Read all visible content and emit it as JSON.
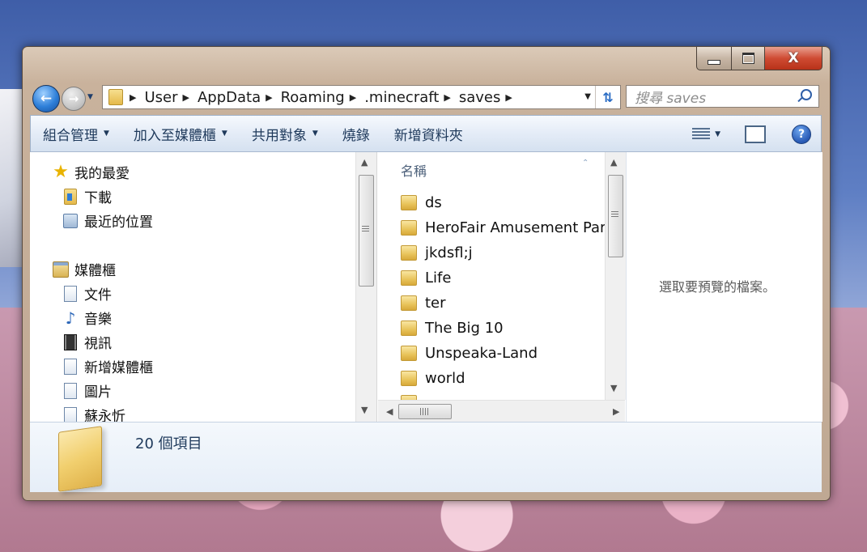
{
  "window": {
    "close_glyph": "X"
  },
  "address_bar": {
    "crumbs": [
      "User",
      "AppData",
      "Roaming",
      ".minecraft",
      "saves"
    ]
  },
  "search": {
    "placeholder": "搜尋 saves"
  },
  "toolbar": {
    "organize": "組合管理",
    "include_library": "加入至媒體櫃",
    "share_with": "共用對象",
    "burn": "燒錄",
    "new_folder": "新增資料夾"
  },
  "nav_pane": {
    "favorites": "我的最愛",
    "downloads": "下載",
    "recent_places": "最近的位置",
    "libraries": "媒體櫃",
    "documents": "文件",
    "music": "音樂",
    "videos": "視訊",
    "new_library": "新增媒體櫃",
    "pictures": "圖片",
    "user_library": "蘇永忻"
  },
  "file_list": {
    "column_name": "名稱",
    "items": [
      "ds",
      "HeroFair Amusement Park",
      "jkdsfl;j",
      "Life",
      "ter",
      "The Big 10",
      "Unspeaka-Land",
      "world"
    ]
  },
  "preview": {
    "message": "選取要預覽的檔案。"
  },
  "details": {
    "item_count": "20 個項目"
  },
  "icons": {
    "back": "back-arrow-icon",
    "forward": "forward-arrow-icon",
    "refresh": "refresh-icon",
    "search": "search-icon",
    "help": "help-icon"
  }
}
